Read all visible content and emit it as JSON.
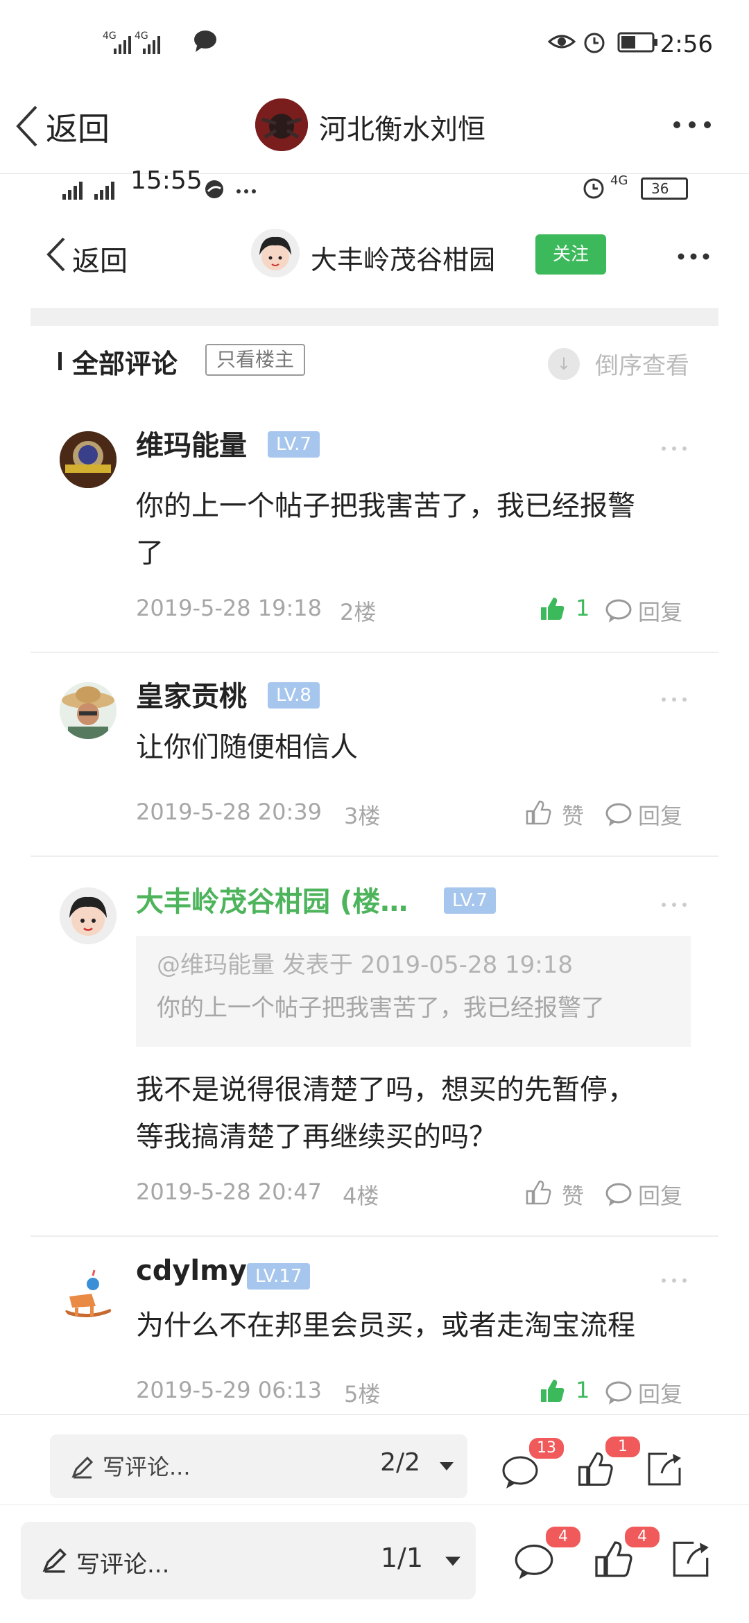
{
  "outer_status": {
    "time": "2:56",
    "net1": "4G",
    "net2": "4G"
  },
  "outer_header": {
    "back_label": "返回",
    "title": "河北衡水刘恒"
  },
  "inner_status": {
    "time": "15:55",
    "net": "4G",
    "battery": "36"
  },
  "inner_header": {
    "back_label": "返回",
    "title": "大丰岭茂谷柑园",
    "follow_label": "关注"
  },
  "section": {
    "title": "全部评论",
    "only_op": "只看楼主",
    "reverse": "倒序查看"
  },
  "comments": [
    {
      "name": "维玛能量",
      "level": "LV.7",
      "text_line1": "你的上一个帖子把我害苦了，我已经报警",
      "text_line2": "了",
      "time": "2019-5-28 19:18",
      "floor": "2楼",
      "likes": "1",
      "reply": "回复"
    },
    {
      "name": "皇家贡桃",
      "level": "LV.8",
      "text_line1": "让你们随便相信人",
      "time": "2019-5-28 20:39",
      "floor": "3楼",
      "like_label": "赞",
      "reply": "回复"
    },
    {
      "name": "大丰岭茂谷柑园 (楼…",
      "level": "LV.7",
      "quote_line1": "@维玛能量 发表于 2019-05-28 19:18",
      "quote_line2": "你的上一个帖子把我害苦了，我已经报警了",
      "text_line1": "我不是说得很清楚了吗，想买的先暂停，",
      "text_line2": "等我搞清楚了再继续买的吗？",
      "time": "2019-5-28 20:47",
      "floor": "4楼",
      "like_label": "赞",
      "reply": "回复"
    },
    {
      "name": "cdylmy",
      "level": "LV.17",
      "text_line1": "为什么不在邦里会员买，或者走淘宝流程",
      "time": "2019-5-29 06:13",
      "floor": "5楼",
      "likes": "1",
      "reply": "回复"
    }
  ],
  "inner_bottom": {
    "placeholder": "写评论...",
    "page": "2/2",
    "comment_badge": "13",
    "like_badge": "1"
  },
  "outer_bottom": {
    "placeholder": "写评论...",
    "page": "1/1",
    "comment_badge": "4",
    "like_badge": "4"
  },
  "colors": {
    "accent_green": "#3cb95a",
    "level_blue": "#a7c6ee",
    "badge_red": "#f05a5a"
  }
}
